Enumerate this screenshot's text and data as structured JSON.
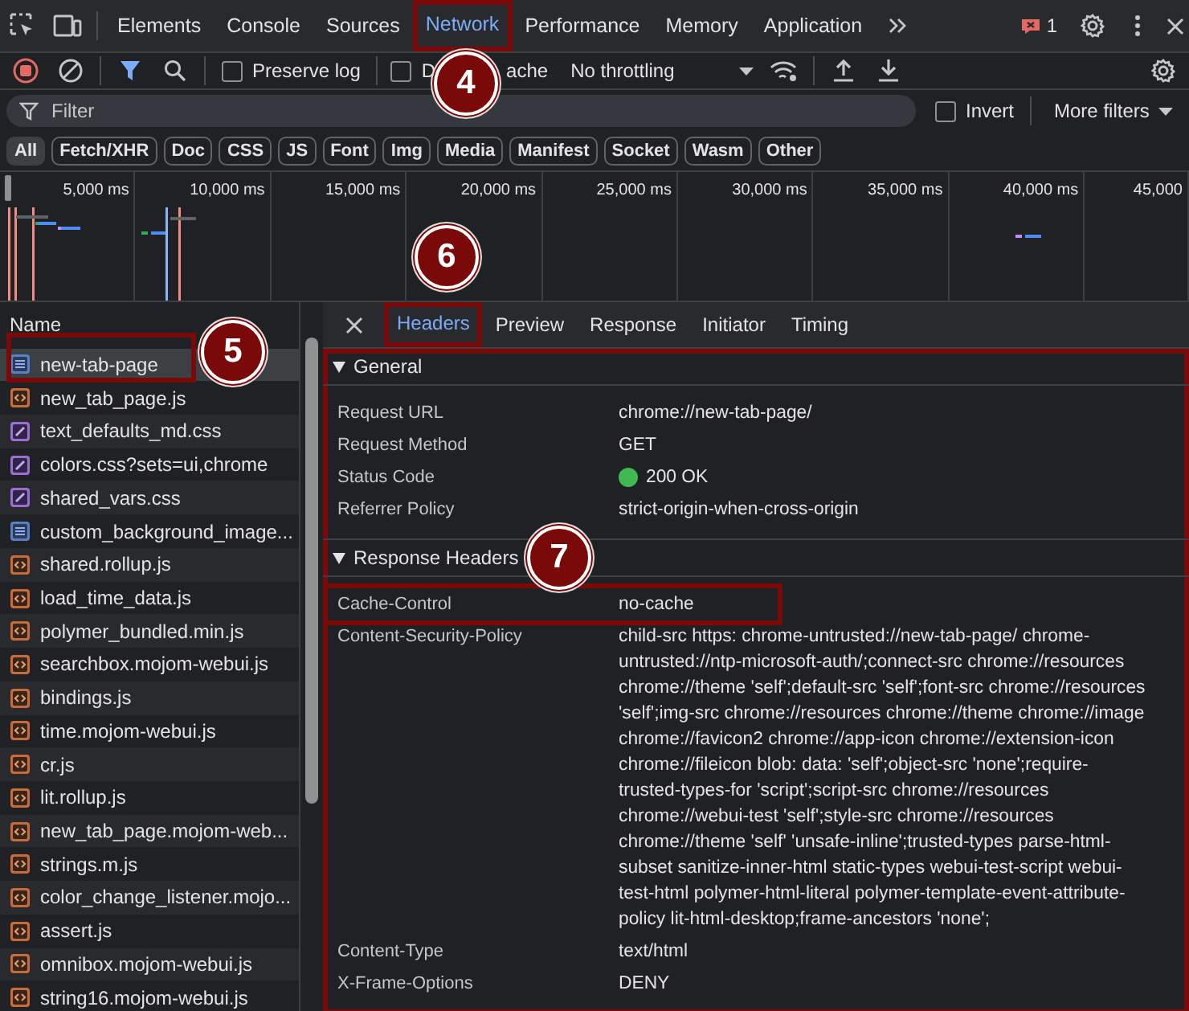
{
  "top_bar": {
    "tabs": [
      {
        "label": "Elements",
        "selected": false
      },
      {
        "label": "Console",
        "selected": false
      },
      {
        "label": "Sources",
        "selected": false
      },
      {
        "label": "Network",
        "selected": true,
        "highlighted": true,
        "callout": "4"
      },
      {
        "label": "Performance",
        "selected": false
      },
      {
        "label": "Memory",
        "selected": false
      },
      {
        "label": "Application",
        "selected": false
      }
    ],
    "issues_count": "1"
  },
  "toolbar": {
    "recording": true,
    "preserve_log": {
      "label": "Preserve log",
      "checked": false
    },
    "disable_cache": {
      "label_parts": [
        "D",
        "ache"
      ],
      "checked": false
    },
    "throttling": "No throttling"
  },
  "filter_bar": {
    "placeholder": "Filter",
    "invert": {
      "label": "Invert",
      "checked": false
    },
    "more_filters": "More filters"
  },
  "type_filters": [
    {
      "label": "All",
      "selected": true
    },
    {
      "label": "Fetch/XHR",
      "selected": false
    },
    {
      "label": "Doc",
      "selected": false
    },
    {
      "label": "CSS",
      "selected": false
    },
    {
      "label": "JS",
      "selected": false
    },
    {
      "label": "Font",
      "selected": false
    },
    {
      "label": "Img",
      "selected": false
    },
    {
      "label": "Media",
      "selected": false
    },
    {
      "label": "Manifest",
      "selected": false
    },
    {
      "label": "Socket",
      "selected": false
    },
    {
      "label": "Wasm",
      "selected": false
    },
    {
      "label": "Other",
      "selected": false
    }
  ],
  "overview": {
    "ticks": [
      "5,000 ms",
      "10,000 ms",
      "15,000 ms",
      "20,000 ms",
      "25,000 ms",
      "30,000 ms",
      "35,000 ms",
      "40,000 ms",
      "45,000"
    ]
  },
  "requests": {
    "column": "Name",
    "rows": [
      {
        "name": "new-tab-page",
        "kind": "document",
        "selected": true,
        "highlighted": true,
        "callout": "5"
      },
      {
        "name": "new_tab_page.js",
        "kind": "script",
        "selected": false
      },
      {
        "name": "text_defaults_md.css",
        "kind": "stylesheet",
        "selected": false
      },
      {
        "name": "colors.css?sets=ui,chrome",
        "kind": "stylesheet",
        "selected": false
      },
      {
        "name": "shared_vars.css",
        "kind": "stylesheet",
        "selected": false
      },
      {
        "name": "custom_background_image...",
        "kind": "document",
        "selected": false
      },
      {
        "name": "shared.rollup.js",
        "kind": "script",
        "selected": false
      },
      {
        "name": "load_time_data.js",
        "kind": "script",
        "selected": false
      },
      {
        "name": "polymer_bundled.min.js",
        "kind": "script",
        "selected": false
      },
      {
        "name": "searchbox.mojom-webui.js",
        "kind": "script",
        "selected": false
      },
      {
        "name": "bindings.js",
        "kind": "script",
        "selected": false
      },
      {
        "name": "time.mojom-webui.js",
        "kind": "script",
        "selected": false
      },
      {
        "name": "cr.js",
        "kind": "script",
        "selected": false
      },
      {
        "name": "lit.rollup.js",
        "kind": "script",
        "selected": false
      },
      {
        "name": "new_tab_page.mojom-web...",
        "kind": "script",
        "selected": false
      },
      {
        "name": "strings.m.js",
        "kind": "script",
        "selected": false
      },
      {
        "name": "color_change_listener.mojo...",
        "kind": "script",
        "selected": false
      },
      {
        "name": "assert.js",
        "kind": "script",
        "selected": false
      },
      {
        "name": "omnibox.mojom-webui.js",
        "kind": "script",
        "selected": false
      },
      {
        "name": "string16.mojom-webui.js",
        "kind": "script",
        "selected": false
      }
    ]
  },
  "details": {
    "highlighted": true,
    "tabs": [
      {
        "label": "Headers",
        "selected": true,
        "highlighted": true,
        "callout": "6"
      },
      {
        "label": "Preview",
        "selected": false
      },
      {
        "label": "Response",
        "selected": false
      },
      {
        "label": "Initiator",
        "selected": false
      },
      {
        "label": "Timing",
        "selected": false
      }
    ],
    "sections": [
      {
        "title": "General",
        "expanded": true,
        "rows": [
          {
            "name": "Request URL",
            "value_lines": [
              "chrome://new-tab-page/"
            ]
          },
          {
            "name": "Request Method",
            "value_lines": [
              "GET"
            ]
          },
          {
            "name": "Status Code",
            "value_lines": [
              "200 OK"
            ],
            "color": "#3fb950"
          },
          {
            "name": "Referrer Policy",
            "value_lines": [
              "strict-origin-when-cross-origin"
            ]
          }
        ]
      },
      {
        "title": "Response Headers",
        "expanded": true,
        "callout": "7",
        "rows": [
          {
            "name": "Cache-Control",
            "value_lines": [
              "no-cache"
            ],
            "highlighted": true
          },
          {
            "name": "Content-Security-Policy",
            "value_lines": [
              "child-src https: chrome-untrusted://new-tab-page/ chrome-",
              "untrusted://ntp-microsoft-auth/;connect-src chrome://resources",
              "chrome://theme 'self';default-src 'self';font-src chrome://resources",
              "'self';img-src chrome://resources chrome://theme chrome://image",
              "chrome://favicon2 chrome://app-icon chrome://extension-icon",
              "chrome://fileicon blob: data: 'self';object-src 'none';require-",
              "trusted-types-for 'script';script-src chrome://resources",
              "chrome://webui-test 'self';style-src chrome://resources",
              "chrome://theme 'self' 'unsafe-inline';trusted-types parse-html-",
              "subset sanitize-inner-html static-types webui-test-script webui-",
              "test-html polymer-html-literal polymer-template-event-attribute-",
              "policy lit-html-desktop;frame-ancestors 'none';"
            ]
          },
          {
            "name": "Content-Type",
            "value_lines": [
              "text/html"
            ]
          },
          {
            "name": "X-Frame-Options",
            "value_lines": [
              "DENY"
            ]
          }
        ]
      }
    ]
  }
}
